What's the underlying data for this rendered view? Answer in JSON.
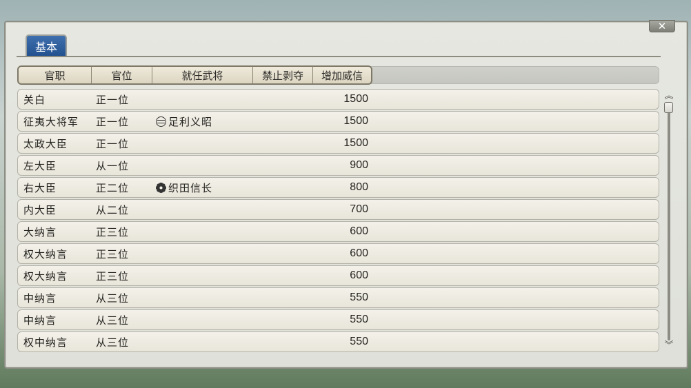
{
  "window": {
    "close_label": "✕"
  },
  "tabs": [
    {
      "label": "基本"
    }
  ],
  "columns": [
    "官职",
    "官位",
    "就任武将",
    "禁止剥夺",
    "增加威信"
  ],
  "rows": [
    {
      "post": "关白",
      "rank": "正一位",
      "general": "",
      "crest": "",
      "prestige": "1500"
    },
    {
      "post": "征夷大将军",
      "rank": "正一位",
      "general": "足利义昭",
      "crest": "ashikaga-crest-icon",
      "prestige": "1500"
    },
    {
      "post": "太政大臣",
      "rank": "正一位",
      "general": "",
      "crest": "",
      "prestige": "1500"
    },
    {
      "post": "左大臣",
      "rank": "从一位",
      "general": "",
      "crest": "",
      "prestige": "900"
    },
    {
      "post": "右大臣",
      "rank": "正二位",
      "general": "织田信长",
      "crest": "oda-crest-icon",
      "prestige": "800"
    },
    {
      "post": "内大臣",
      "rank": "从二位",
      "general": "",
      "crest": "",
      "prestige": "700"
    },
    {
      "post": "大纳言",
      "rank": "正三位",
      "general": "",
      "crest": "",
      "prestige": "600"
    },
    {
      "post": "权大纳言",
      "rank": "正三位",
      "general": "",
      "crest": "",
      "prestige": "600"
    },
    {
      "post": "权大纳言",
      "rank": "正三位",
      "general": "",
      "crest": "",
      "prestige": "600"
    },
    {
      "post": "中纳言",
      "rank": "从三位",
      "general": "",
      "crest": "",
      "prestige": "550"
    },
    {
      "post": "中纳言",
      "rank": "从三位",
      "general": "",
      "crest": "",
      "prestige": "550"
    },
    {
      "post": "权中纳言",
      "rank": "从三位",
      "general": "",
      "crest": "",
      "prestige": "550"
    }
  ],
  "scrollbar": {
    "up_icon": "up-arrow-icon",
    "down_icon": "down-arrow-icon",
    "position": 0
  }
}
